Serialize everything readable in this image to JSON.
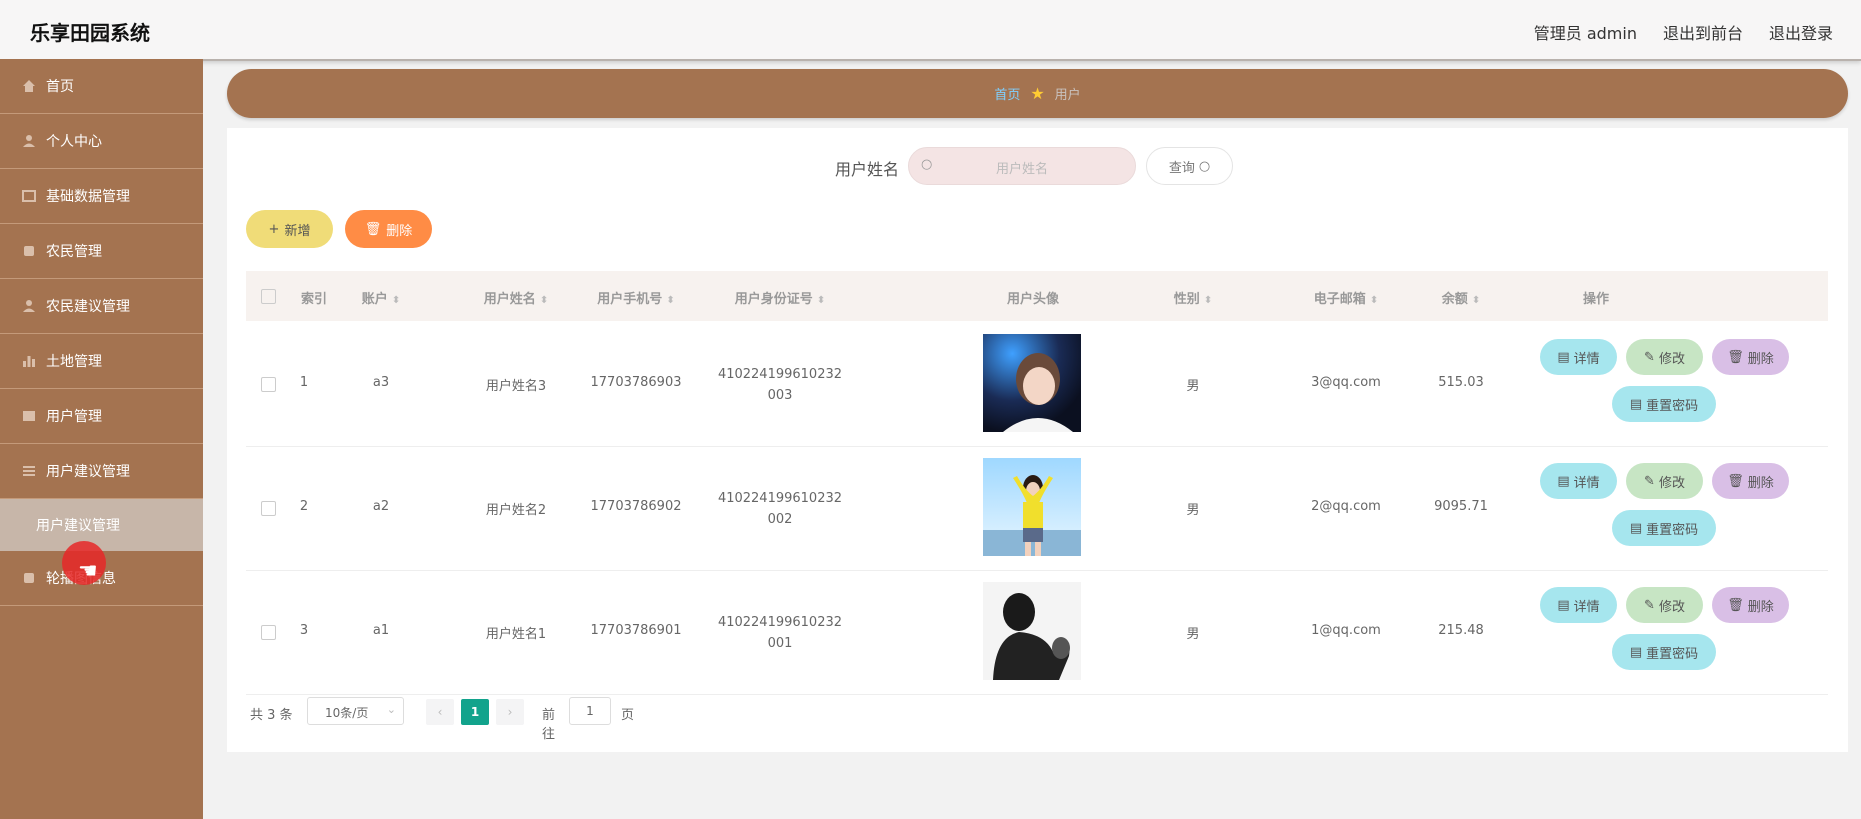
{
  "app": {
    "title": "乐享田园系统"
  },
  "top_links": {
    "admin": "管理员 admin",
    "front": "退出到前台",
    "logout": "退出登录"
  },
  "sidebar": {
    "items": [
      {
        "label": "首页",
        "icon": "home-icon"
      },
      {
        "label": "个人中心",
        "icon": "user-icon"
      },
      {
        "label": "基础数据管理",
        "icon": "grid-icon"
      },
      {
        "label": "农民管理",
        "icon": "grid-icon"
      },
      {
        "label": "农民建议管理",
        "icon": "user-icon"
      },
      {
        "label": "土地管理",
        "icon": "chart-icon"
      },
      {
        "label": "用户管理",
        "icon": "grid-icon"
      },
      {
        "label": "用户建议管理",
        "icon": "list-icon"
      }
    ],
    "sub_item": "用户建议管理",
    "last_item": {
      "label": "轮播图信息",
      "icon": "grid-icon"
    }
  },
  "breadcrumb": {
    "home": "首页",
    "current": "用户"
  },
  "search": {
    "label": "用户姓名",
    "placeholder": "用户姓名",
    "button": "查询"
  },
  "toolbar": {
    "add": "新增",
    "delete": "删除"
  },
  "table": {
    "columns": [
      "索引",
      "账户",
      "用户姓名",
      "用户手机号",
      "用户身份证号",
      "用户头像",
      "性别",
      "电子邮箱",
      "余额",
      "操作"
    ],
    "rows": [
      {
        "index": "1",
        "account": "a3",
        "name": "用户姓名3",
        "phone": "17703786903",
        "id_line1": "410224199610232",
        "id_line2": "003",
        "gender": "男",
        "email": "3@qq.com",
        "balance": "515.03"
      },
      {
        "index": "2",
        "account": "a2",
        "name": "用户姓名2",
        "phone": "17703786902",
        "id_line1": "410224199610232",
        "id_line2": "002",
        "gender": "男",
        "email": "2@qq.com",
        "balance": "9095.71"
      },
      {
        "index": "3",
        "account": "a1",
        "name": "用户姓名1",
        "phone": "17703786901",
        "id_line1": "410224199610232",
        "id_line2": "001",
        "gender": "男",
        "email": "1@qq.com",
        "balance": "215.48"
      }
    ],
    "actions": {
      "detail": "详情",
      "edit": "修改",
      "delete": "删除",
      "reset": "重置密码"
    }
  },
  "pagination": {
    "total": "共 3 条",
    "page_size": "10条/页",
    "current_page": "1",
    "goto_label": "前往",
    "goto_value": "1",
    "goto_unit": "页"
  }
}
